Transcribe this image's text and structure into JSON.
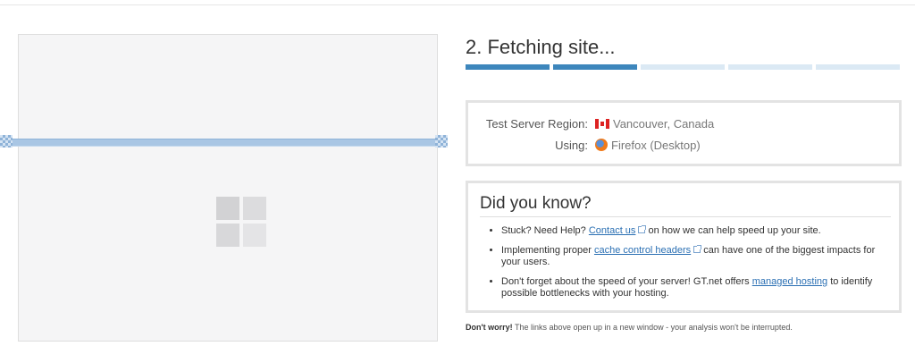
{
  "step": {
    "title": "2. Fetching site...",
    "progress_done": 2,
    "progress_total": 5
  },
  "server": {
    "region_label": "Test Server Region:",
    "region_value": "Vancouver, Canada",
    "using_label": "Using:",
    "using_value": "Firefox (Desktop)"
  },
  "tips": {
    "title": "Did you know?",
    "items": [
      {
        "before": "Stuck? Need Help? ",
        "link": "Contact us",
        "after": " on how we can help speed up your site."
      },
      {
        "before": "Implementing proper ",
        "link": "cache control headers",
        "after": " can have one of the biggest impacts for your users."
      },
      {
        "before": "Don't forget about the speed of your server! GT.net offers ",
        "link": "managed hosting",
        "after": " to identify possible bottlenecks with your hosting."
      }
    ]
  },
  "footer": {
    "strong": "Don't worry!",
    "text": " The links above open up in a new window - your analysis won't be interrupted."
  },
  "colors": {
    "accent": "#3d86bc",
    "progress_track": "#dbe9f4",
    "link": "#2a6fb3"
  },
  "icons": {
    "region": "canada-flag-icon",
    "browser": "firefox-icon",
    "external": "external-link-icon",
    "preview": "windows-logo-icon"
  }
}
